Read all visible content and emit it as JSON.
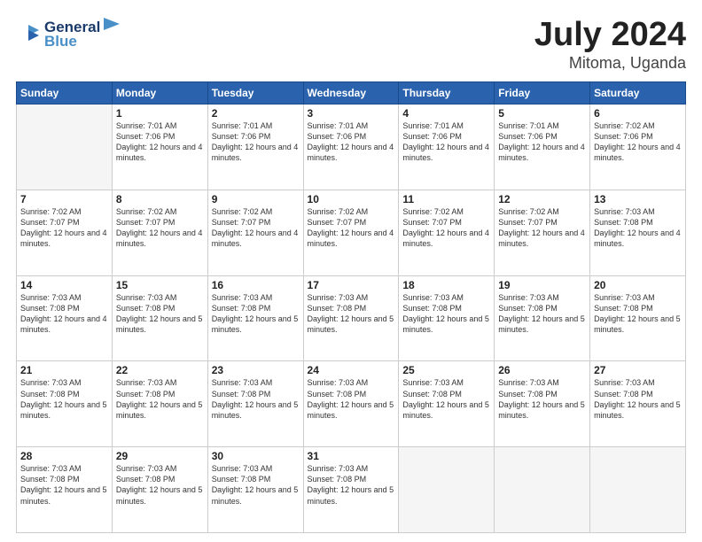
{
  "header": {
    "logo_line1": "General",
    "logo_line2": "Blue",
    "month": "July 2024",
    "location": "Mitoma, Uganda"
  },
  "days_of_week": [
    "Sunday",
    "Monday",
    "Tuesday",
    "Wednesday",
    "Thursday",
    "Friday",
    "Saturday"
  ],
  "weeks": [
    [
      {
        "day": "",
        "empty": true
      },
      {
        "day": "1",
        "sunrise": "7:01 AM",
        "sunset": "7:06 PM",
        "daylight": "12 hours and 4 minutes."
      },
      {
        "day": "2",
        "sunrise": "7:01 AM",
        "sunset": "7:06 PM",
        "daylight": "12 hours and 4 minutes."
      },
      {
        "day": "3",
        "sunrise": "7:01 AM",
        "sunset": "7:06 PM",
        "daylight": "12 hours and 4 minutes."
      },
      {
        "day": "4",
        "sunrise": "7:01 AM",
        "sunset": "7:06 PM",
        "daylight": "12 hours and 4 minutes."
      },
      {
        "day": "5",
        "sunrise": "7:01 AM",
        "sunset": "7:06 PM",
        "daylight": "12 hours and 4 minutes."
      },
      {
        "day": "6",
        "sunrise": "7:02 AM",
        "sunset": "7:06 PM",
        "daylight": "12 hours and 4 minutes."
      }
    ],
    [
      {
        "day": "7",
        "sunrise": "7:02 AM",
        "sunset": "7:07 PM",
        "daylight": "12 hours and 4 minutes."
      },
      {
        "day": "8",
        "sunrise": "7:02 AM",
        "sunset": "7:07 PM",
        "daylight": "12 hours and 4 minutes."
      },
      {
        "day": "9",
        "sunrise": "7:02 AM",
        "sunset": "7:07 PM",
        "daylight": "12 hours and 4 minutes."
      },
      {
        "day": "10",
        "sunrise": "7:02 AM",
        "sunset": "7:07 PM",
        "daylight": "12 hours and 4 minutes."
      },
      {
        "day": "11",
        "sunrise": "7:02 AM",
        "sunset": "7:07 PM",
        "daylight": "12 hours and 4 minutes."
      },
      {
        "day": "12",
        "sunrise": "7:02 AM",
        "sunset": "7:07 PM",
        "daylight": "12 hours and 4 minutes."
      },
      {
        "day": "13",
        "sunrise": "7:03 AM",
        "sunset": "7:08 PM",
        "daylight": "12 hours and 4 minutes."
      }
    ],
    [
      {
        "day": "14",
        "sunrise": "7:03 AM",
        "sunset": "7:08 PM",
        "daylight": "12 hours and 4 minutes."
      },
      {
        "day": "15",
        "sunrise": "7:03 AM",
        "sunset": "7:08 PM",
        "daylight": "12 hours and 5 minutes."
      },
      {
        "day": "16",
        "sunrise": "7:03 AM",
        "sunset": "7:08 PM",
        "daylight": "12 hours and 5 minutes."
      },
      {
        "day": "17",
        "sunrise": "7:03 AM",
        "sunset": "7:08 PM",
        "daylight": "12 hours and 5 minutes."
      },
      {
        "day": "18",
        "sunrise": "7:03 AM",
        "sunset": "7:08 PM",
        "daylight": "12 hours and 5 minutes."
      },
      {
        "day": "19",
        "sunrise": "7:03 AM",
        "sunset": "7:08 PM",
        "daylight": "12 hours and 5 minutes."
      },
      {
        "day": "20",
        "sunrise": "7:03 AM",
        "sunset": "7:08 PM",
        "daylight": "12 hours and 5 minutes."
      }
    ],
    [
      {
        "day": "21",
        "sunrise": "7:03 AM",
        "sunset": "7:08 PM",
        "daylight": "12 hours and 5 minutes."
      },
      {
        "day": "22",
        "sunrise": "7:03 AM",
        "sunset": "7:08 PM",
        "daylight": "12 hours and 5 minutes."
      },
      {
        "day": "23",
        "sunrise": "7:03 AM",
        "sunset": "7:08 PM",
        "daylight": "12 hours and 5 minutes."
      },
      {
        "day": "24",
        "sunrise": "7:03 AM",
        "sunset": "7:08 PM",
        "daylight": "12 hours and 5 minutes."
      },
      {
        "day": "25",
        "sunrise": "7:03 AM",
        "sunset": "7:08 PM",
        "daylight": "12 hours and 5 minutes."
      },
      {
        "day": "26",
        "sunrise": "7:03 AM",
        "sunset": "7:08 PM",
        "daylight": "12 hours and 5 minutes."
      },
      {
        "day": "27",
        "sunrise": "7:03 AM",
        "sunset": "7:08 PM",
        "daylight": "12 hours and 5 minutes."
      }
    ],
    [
      {
        "day": "28",
        "sunrise": "7:03 AM",
        "sunset": "7:08 PM",
        "daylight": "12 hours and 5 minutes."
      },
      {
        "day": "29",
        "sunrise": "7:03 AM",
        "sunset": "7:08 PM",
        "daylight": "12 hours and 5 minutes."
      },
      {
        "day": "30",
        "sunrise": "7:03 AM",
        "sunset": "7:08 PM",
        "daylight": "12 hours and 5 minutes."
      },
      {
        "day": "31",
        "sunrise": "7:03 AM",
        "sunset": "7:08 PM",
        "daylight": "12 hours and 5 minutes."
      },
      {
        "day": "",
        "empty": true
      },
      {
        "day": "",
        "empty": true
      },
      {
        "day": "",
        "empty": true
      }
    ]
  ]
}
